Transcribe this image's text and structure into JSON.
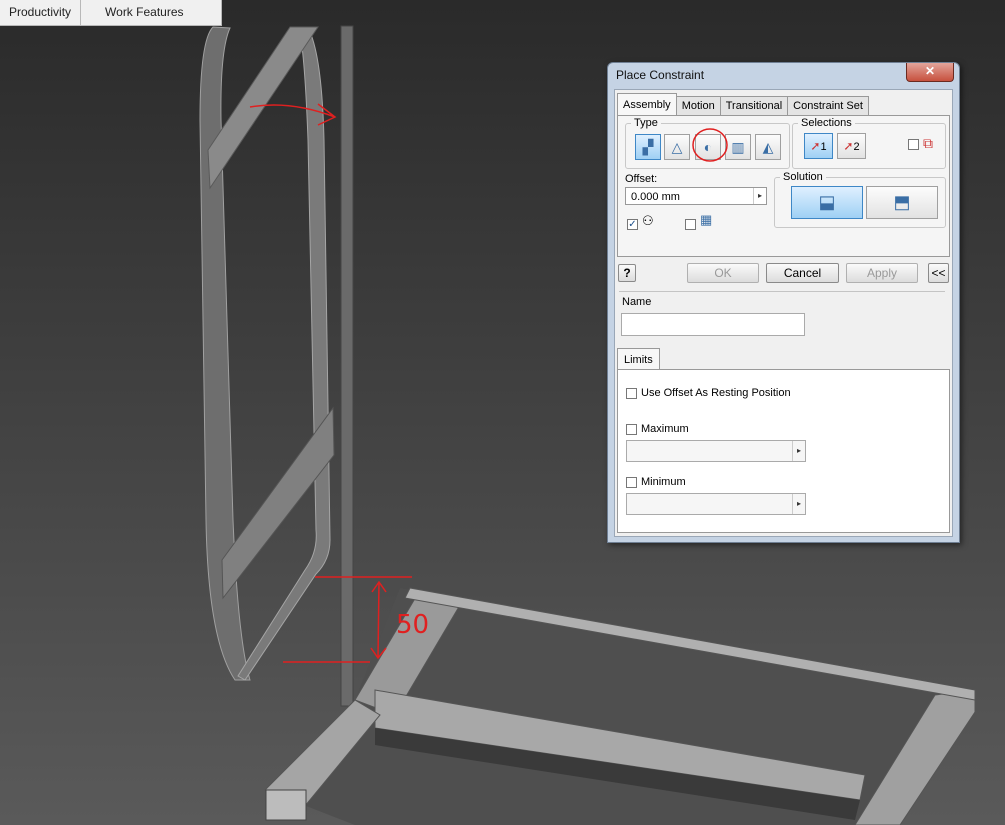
{
  "ribbon": {
    "tabs": [
      "Productivity",
      "Work Features"
    ]
  },
  "viewport": {
    "annotation_text": "50",
    "colors": {
      "background_top": "#2a2a2a",
      "background_bottom": "#5a5a5a",
      "annotation": "#e02020",
      "model": "#7d7d7d"
    }
  },
  "dialog": {
    "title": "Place Constraint",
    "close_label": "✕",
    "tabs": [
      "Assembly",
      "Motion",
      "Transitional",
      "Constraint Set"
    ],
    "active_tab": "Assembly",
    "type_group_label": "Type",
    "type_icons": [
      "mate-icon",
      "angle-icon",
      "tangent-icon",
      "insert-icon",
      "symmetry-icon"
    ],
    "selected_type": "tangent-icon",
    "selections_group_label": "Selections",
    "selection_1_label": "1",
    "selection_2_label": "2",
    "offset_label": "Offset:",
    "offset_value": "0.000 mm",
    "solution_group_label": "Solution",
    "ok_label": "OK",
    "cancel_label": "Cancel",
    "apply_label": "Apply",
    "expand_label": "<<",
    "help_label": "?",
    "name_label": "Name",
    "name_value": "",
    "limits_tab_label": "Limits",
    "use_offset_label": "Use Offset As Resting Position",
    "maximum_label": "Maximum",
    "minimum_label": "Minimum"
  }
}
